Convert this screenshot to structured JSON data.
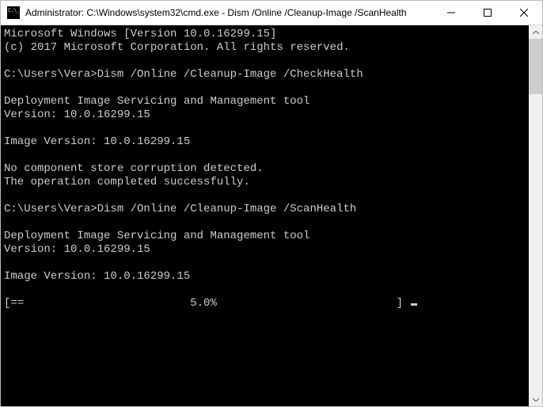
{
  "window": {
    "title": "Administrator: C:\\Windows\\system32\\cmd.exe - Dism  /Online /Cleanup-Image /ScanHealth"
  },
  "terminal": {
    "lines": [
      "Microsoft Windows [Version 10.0.16299.15]",
      "(c) 2017 Microsoft Corporation. All rights reserved.",
      "",
      "C:\\Users\\Vera>Dism /Online /Cleanup-Image /CheckHealth",
      "",
      "Deployment Image Servicing and Management tool",
      "Version: 10.0.16299.15",
      "",
      "Image Version: 10.0.16299.15",
      "",
      "No component store corruption detected.",
      "The operation completed successfully.",
      "",
      "C:\\Users\\Vera>Dism /Online /Cleanup-Image /ScanHealth",
      "",
      "Deployment Image Servicing and Management tool",
      "Version: 10.0.16299.15",
      "",
      "Image Version: 10.0.16299.15",
      ""
    ],
    "progress_line": "[==                         5.0%                           ] "
  }
}
